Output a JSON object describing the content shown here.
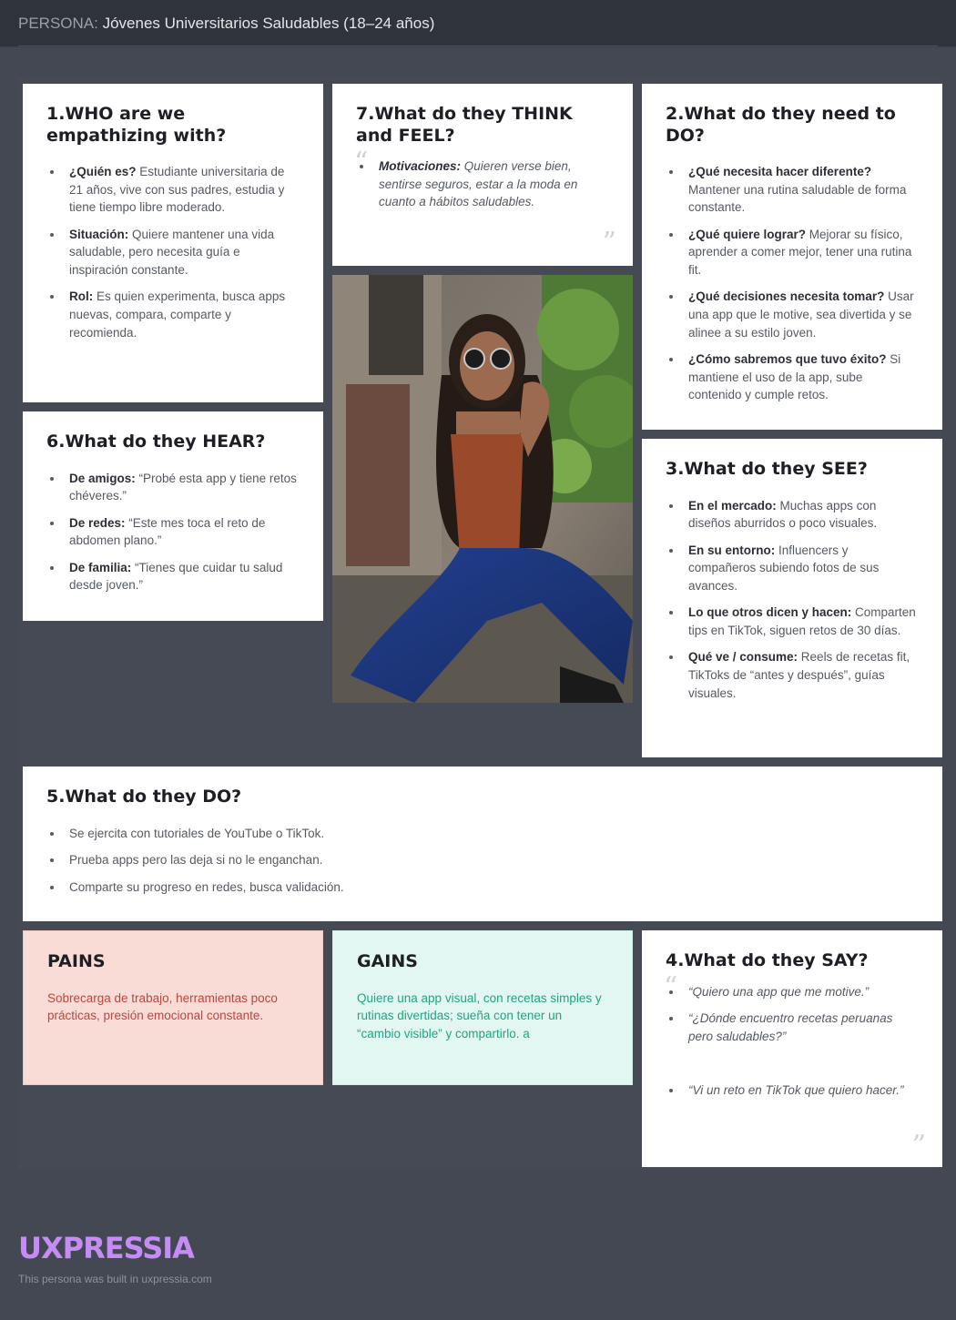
{
  "header": {
    "label": "PERSONA:",
    "title": "Jóvenes Universitarios Saludables (18–24 años)"
  },
  "who": {
    "title": "1.WHO are we empathizing with?",
    "items": [
      {
        "bold": "¿Quién es?",
        "text": " Estudiante universitaria de 21 años, vive con sus padres, estudia y tiene tiempo libre moderado."
      },
      {
        "bold": "Situación:",
        "text": " Quiere mantener una vida saludable, pero necesita guía e inspiración constante."
      },
      {
        "bold": "Rol:",
        "text": " Es quien experimenta, busca apps nuevas, compara, comparte y recomienda."
      }
    ]
  },
  "think": {
    "title": "7.What do they THINK and FEEL?",
    "items": [
      {
        "bold": "Motivaciones:",
        "text": " Quieren verse bien, sentirse seguros, estar a la moda en cuanto a hábitos saludables."
      }
    ]
  },
  "need": {
    "title": "2.What do they need to DO?",
    "items": [
      {
        "bold": "¿Qué necesita hacer diferente?",
        "text": " Mantener una rutina saludable de forma constante."
      },
      {
        "bold": "¿Qué quiere lograr?",
        "text": " Mejorar su físico, aprender a comer mejor, tener una rutina fit."
      },
      {
        "bold": "¿Qué decisiones necesita tomar?",
        "text": " Usar una app que le motive, sea divertida y se alinee a su estilo joven."
      },
      {
        "bold": "¿Cómo sabremos que tuvo éxito?",
        "text": " Si mantiene el uso de la app, sube contenido y cumple retos."
      }
    ]
  },
  "hear": {
    "title": "6.What do they HEAR?",
    "items": [
      {
        "bold": "De amigos:",
        "text": " “Probé esta app y tiene retos chéveres.”"
      },
      {
        "bold": "De redes:",
        "text": " “Este mes toca el reto de abdomen plano.”"
      },
      {
        "bold": "De familia:",
        "text": " “Tienes que cuidar tu salud desde joven.”"
      }
    ]
  },
  "see": {
    "title": "3.What do they SEE?",
    "items": [
      {
        "bold": "En el mercado:",
        "text": " Muchas apps con diseños aburridos o poco visuales."
      },
      {
        "bold": "En su entorno:",
        "text": " Influencers y compañeros subiendo fotos de sus avances."
      },
      {
        "bold": "Lo que otros dicen y hacen:",
        "text": " Comparten tips en TikTok, siguen retos de 30 días."
      },
      {
        "bold": "Qué ve / consume:",
        "text": " Reels de recetas fit, TikToks de “antes y después”, guías visuales."
      }
    ]
  },
  "do": {
    "title": "5.What do they DO?",
    "items": [
      "Se ejercita con tutoriales de YouTube o TikTok.",
      "Prueba apps pero las deja si no le enganchan.",
      "Comparte su progreso en redes, busca validación."
    ]
  },
  "pains": {
    "title": "PAINS",
    "text": "Sobrecarga de trabajo, herramientas poco prácticas, presión emocional constante."
  },
  "gains": {
    "title": "GAINS",
    "text": "Quiere una app visual, con recetas simples y rutinas divertidas; sueña con tener un “cambio visible” y compartirlo. a"
  },
  "say": {
    "title": "4.What do they SAY?",
    "items": [
      "“Quiero una app que me motive.”",
      "“¿Dónde encuentro recetas peruanas pero saludables?”",
      "“Vi un reto en TikTok que quiero hacer.”"
    ]
  },
  "quote_marks": {
    "open": "“",
    "close": "”"
  },
  "footer": {
    "logo": "UXPRESSIA",
    "note": "This persona was built in uxpressia.com"
  },
  "colors": {
    "background": "#434853",
    "pains_bg": "#fadcd7",
    "pains_text": "#c0453d",
    "gains_bg": "#e3f7f2",
    "gains_text": "#1fa584",
    "logo": "#c58cf5"
  },
  "photo_icon": "persona-photo"
}
